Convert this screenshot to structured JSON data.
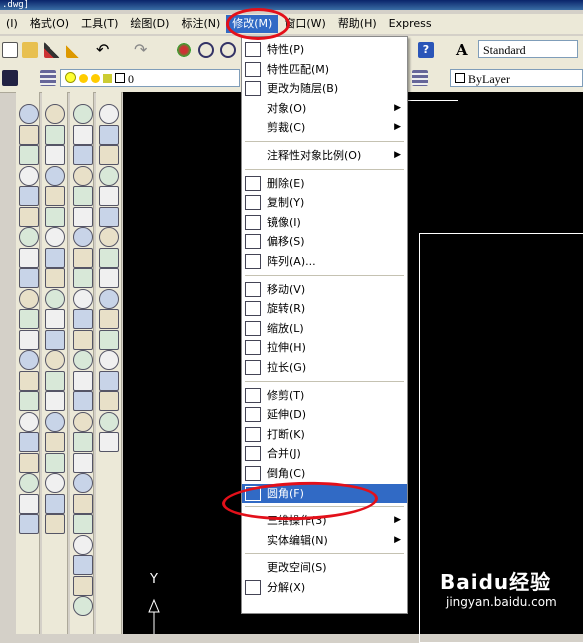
{
  "title": ".dwg]",
  "menubar": [
    {
      "label": "(I)"
    },
    {
      "label": "格式(O)"
    },
    {
      "label": "工具(T)"
    },
    {
      "label": "绘图(D)"
    },
    {
      "label": "标注(N)"
    },
    {
      "label": "修改(M)",
      "active": true
    },
    {
      "label": "窗口(W)"
    },
    {
      "label": "帮助(H)"
    },
    {
      "label": "Express"
    }
  ],
  "toolbar": {
    "style_combo": "Standard",
    "layer_combo": "ByLayer",
    "layer_value": "0"
  },
  "menu": {
    "items": [
      {
        "label": "特性(P)",
        "icon": "properties-icon"
      },
      {
        "label": "特性匹配(M)",
        "icon": "match-properties-icon"
      },
      {
        "label": "更改为随层(B)",
        "icon": "set-bylayer-icon"
      },
      {
        "label": "对象(O)",
        "submenu": true
      },
      {
        "label": "剪裁(C)",
        "submenu": true
      },
      {
        "sep": true
      },
      {
        "label": "注释性对象比例(O)",
        "submenu": true
      },
      {
        "sep": true
      },
      {
        "label": "删除(E)",
        "icon": "erase-icon"
      },
      {
        "label": "复制(Y)",
        "icon": "copy-icon"
      },
      {
        "label": "镜像(I)",
        "icon": "mirror-icon"
      },
      {
        "label": "偏移(S)",
        "icon": "offset-icon"
      },
      {
        "label": "阵列(A)...",
        "icon": "array-icon"
      },
      {
        "sep": true
      },
      {
        "label": "移动(V)",
        "icon": "move-icon"
      },
      {
        "label": "旋转(R)",
        "icon": "rotate-icon"
      },
      {
        "label": "缩放(L)",
        "icon": "scale-icon"
      },
      {
        "label": "拉伸(H)",
        "icon": "stretch-icon"
      },
      {
        "label": "拉长(G)",
        "icon": "lengthen-icon"
      },
      {
        "sep": true
      },
      {
        "label": "修剪(T)",
        "icon": "trim-icon"
      },
      {
        "label": "延伸(D)",
        "icon": "extend-icon"
      },
      {
        "label": "打断(K)",
        "icon": "break-icon"
      },
      {
        "label": "合并(J)",
        "icon": "join-icon"
      },
      {
        "label": "倒角(C)",
        "icon": "chamfer-icon"
      },
      {
        "label": "圆角(F)",
        "icon": "fillet-icon",
        "highlighted": true
      },
      {
        "sep": true
      },
      {
        "label": "三维操作(3)",
        "submenu": true
      },
      {
        "label": "实体编辑(N)",
        "submenu": true
      },
      {
        "sep": true
      },
      {
        "label": "更改空间(S)"
      },
      {
        "label": "分解(X)",
        "icon": "explode-icon"
      }
    ]
  },
  "canvas": {
    "axis_label": "Y"
  },
  "watermark": {
    "line1": "Baidu经验",
    "line2": "jingyan.baidu.com"
  },
  "colors": {
    "highlight": "#316ac5",
    "annotation": "#e3101a",
    "canvas": "#000000"
  }
}
